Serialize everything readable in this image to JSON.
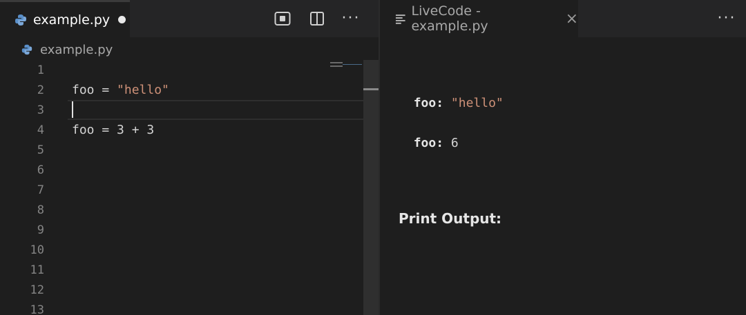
{
  "left_tab": {
    "filename": "example.py",
    "icon": "python-file-icon"
  },
  "left_actions": {
    "run": "run-preview-icon",
    "split": "split-editor-icon",
    "more": "···"
  },
  "breadcrumb": {
    "filename": "example.py",
    "icon": "python-file-icon"
  },
  "editor": {
    "lines": [
      {
        "number": "1",
        "code": ""
      },
      {
        "number": "2",
        "code_prefix": "foo = ",
        "code_string": "\"hello\""
      },
      {
        "number": "3",
        "code": ""
      },
      {
        "number": "4",
        "code": "foo = 3 + 3"
      },
      {
        "number": "5",
        "code": ""
      },
      {
        "number": "6",
        "code": ""
      },
      {
        "number": "7",
        "code": ""
      },
      {
        "number": "8",
        "code": ""
      },
      {
        "number": "9",
        "code": ""
      },
      {
        "number": "10",
        "code": ""
      },
      {
        "number": "11",
        "code": ""
      },
      {
        "number": "12",
        "code": ""
      },
      {
        "number": "13",
        "code": ""
      }
    ],
    "cursor_line": "3"
  },
  "right_tab": {
    "title": "LiveCode - example.py",
    "close": "×",
    "icon": "preview-lines-icon"
  },
  "right_actions": {
    "more": "···"
  },
  "output": {
    "vars": [
      {
        "key": "foo:",
        "value": "\"hello\"",
        "is_string": true
      },
      {
        "key": "foo:",
        "value": "6",
        "is_string": false
      }
    ],
    "print_heading": "Print Output:"
  },
  "colors": {
    "background": "#1e1e1e",
    "tabbar": "#252526",
    "string": "#ce9178",
    "text": "#d4d4d4",
    "line_number": "#858585"
  }
}
